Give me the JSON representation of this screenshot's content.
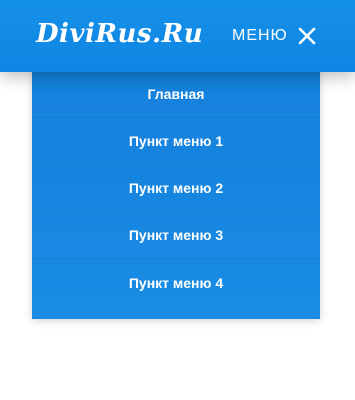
{
  "header": {
    "logo_text": "DiviRus.Ru",
    "menu_label": "МЕНЮ",
    "close_icon": "close-icon"
  },
  "menu": {
    "items": [
      {
        "label": "Главная"
      },
      {
        "label": "Пункт меню 1"
      },
      {
        "label": "Пункт меню 2"
      },
      {
        "label": "Пункт меню 3"
      },
      {
        "label": "Пункт меню 4"
      }
    ]
  },
  "colors": {
    "header_bg": "#1590e8",
    "menu_bg": "#1684df",
    "text": "#ffffff",
    "page_bg": "#ffffff"
  }
}
